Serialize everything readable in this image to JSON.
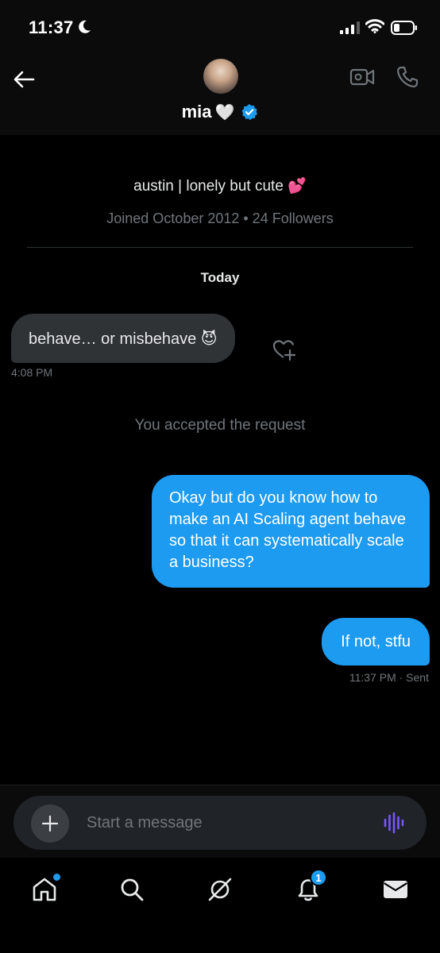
{
  "status_bar": {
    "time": "11:37"
  },
  "header": {
    "contact_name": "mia",
    "name_emoji": "🤍"
  },
  "profile": {
    "bio": "austin | lonely but cute 💕",
    "joined": "Joined October 2012 • 24 Followers"
  },
  "conversation": {
    "day_label": "Today",
    "received_message": "behave… or misbehave 😈",
    "received_time": "4:08 PM",
    "system_message": "You accepted the request",
    "sent_messages": [
      "Okay but do you know how to make an AI Scaling agent behave so that it can systematically scale a business?",
      "If not, stfu"
    ],
    "sent_status": "11:37 PM · Sent"
  },
  "composer": {
    "placeholder": "Start a message"
  },
  "bottom_nav": {
    "notification_count": "1"
  },
  "colors": {
    "accent": "#1d9bf0",
    "bubble_received": "#2f3336",
    "muted_text": "#71767b"
  }
}
